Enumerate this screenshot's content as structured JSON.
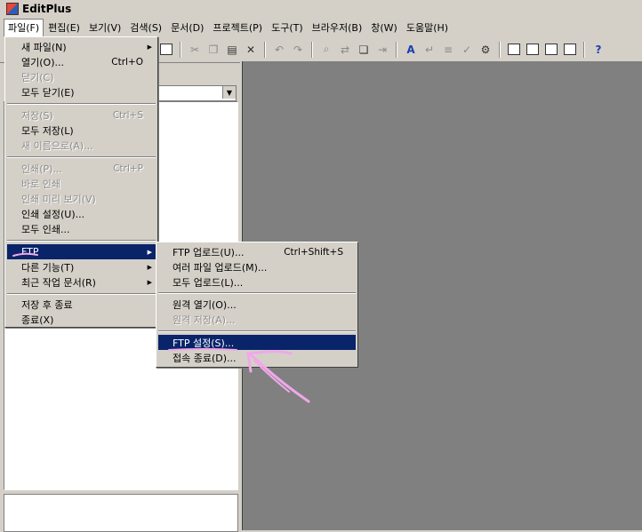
{
  "window": {
    "title": "EditPlus"
  },
  "menubar": {
    "items": [
      "파일(F)",
      "편집(E)",
      "보기(V)",
      "검색(S)",
      "문서(D)",
      "프로젝트(P)",
      "도구(T)",
      "브라우저(B)",
      "창(W)",
      "도움말(H)"
    ]
  },
  "file_menu": {
    "items": [
      {
        "label": "새 파일(N)",
        "shortcut": "",
        "has_submenu": true,
        "disabled": false
      },
      {
        "label": "열기(O)...",
        "shortcut": "Ctrl+O",
        "has_submenu": false,
        "disabled": false
      },
      {
        "label": "닫기(C)",
        "shortcut": "",
        "has_submenu": false,
        "disabled": true
      },
      {
        "label": "모두 닫기(E)",
        "shortcut": "",
        "has_submenu": false,
        "disabled": false
      },
      {
        "label": "저장(S)",
        "shortcut": "Ctrl+S",
        "has_submenu": false,
        "disabled": true
      },
      {
        "label": "모두 저장(L)",
        "shortcut": "",
        "has_submenu": false,
        "disabled": false
      },
      {
        "label": "새 이름으로(A)...",
        "shortcut": "",
        "has_submenu": false,
        "disabled": true
      },
      {
        "label": "인쇄(P)...",
        "shortcut": "Ctrl+P",
        "has_submenu": false,
        "disabled": true
      },
      {
        "label": "바로 인쇄",
        "shortcut": "",
        "has_submenu": false,
        "disabled": true
      },
      {
        "label": "인쇄 미리 보기(V)",
        "shortcut": "",
        "has_submenu": false,
        "disabled": true
      },
      {
        "label": "인쇄 설정(U)...",
        "shortcut": "",
        "has_submenu": false,
        "disabled": false
      },
      {
        "label": "모두 인쇄...",
        "shortcut": "",
        "has_submenu": false,
        "disabled": false
      },
      {
        "label": "FTP",
        "shortcut": "",
        "has_submenu": true,
        "disabled": false
      },
      {
        "label": "다른 기능(T)",
        "shortcut": "",
        "has_submenu": true,
        "disabled": false
      },
      {
        "label": "최근 작업 문서(R)",
        "shortcut": "",
        "has_submenu": true,
        "disabled": false
      },
      {
        "label": "저장 후 종료",
        "shortcut": "",
        "has_submenu": false,
        "disabled": false
      },
      {
        "label": "종료(X)",
        "shortcut": "",
        "has_submenu": false,
        "disabled": false
      }
    ]
  },
  "ftp_submenu": {
    "items": [
      {
        "label": "FTP 업로드(U)...",
        "shortcut": "Ctrl+Shift+S",
        "disabled": false
      },
      {
        "label": "여러 파일 업로드(M)...",
        "shortcut": "",
        "disabled": false
      },
      {
        "label": "모두 업로드(L)...",
        "shortcut": "",
        "disabled": false
      },
      {
        "label": "원격 열기(O)...",
        "shortcut": "",
        "disabled": false
      },
      {
        "label": "원격 저장(A)...",
        "shortcut": "",
        "disabled": true
      },
      {
        "label": "FTP 설정(S)...",
        "shortcut": "",
        "disabled": false
      },
      {
        "label": "접속 종료(D)...",
        "shortcut": "",
        "disabled": false
      }
    ]
  },
  "icons": {
    "submenu_arrow": "▶",
    "combo_arrow": "▼"
  },
  "colors": {
    "menu_bg": "#d4d0c8",
    "selected_bg": "#0a246a",
    "workspace_bg": "#808080",
    "annotation_pink": "#f0a8e8"
  }
}
